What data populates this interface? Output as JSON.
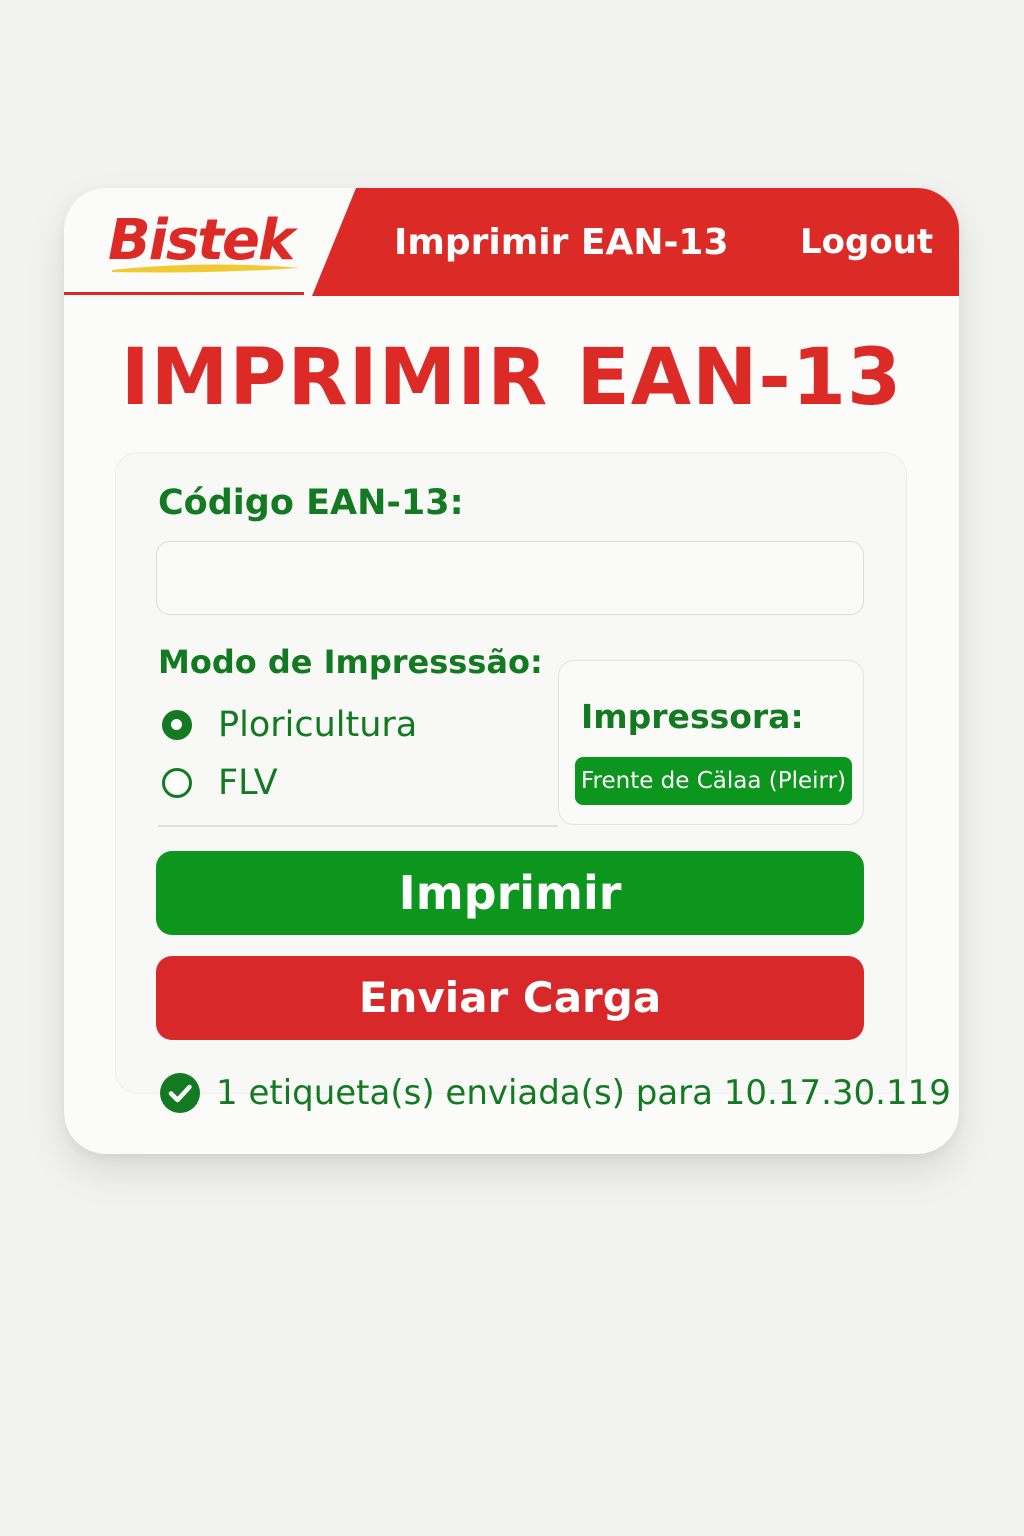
{
  "brand": {
    "logo_text": "Bistek",
    "primary_color": "#dc2a27",
    "accent_green": "#0d961e",
    "text_green": "#137a22"
  },
  "nav": {
    "title": "Imprimir EAN-13",
    "logout_label": "Logout"
  },
  "page": {
    "heading": "IMPRIMIR EAN-13"
  },
  "form": {
    "code_label": "Código EAN-13:",
    "code_value": "",
    "mode_label": "Modo de Impresssão:",
    "modes": [
      {
        "label": "Ploricultura",
        "selected": true
      },
      {
        "label": "FLV",
        "selected": false
      }
    ],
    "printer_label": "Impressora:",
    "printer_selected": "Frente de Cälaa (Pleirr)",
    "print_button": "Imprimir",
    "send_button": "Enviar Carga"
  },
  "status": {
    "message": "1 etiqueta(s) enviada(s) para 10.17.30.119",
    "icon": "check-circle-icon"
  }
}
